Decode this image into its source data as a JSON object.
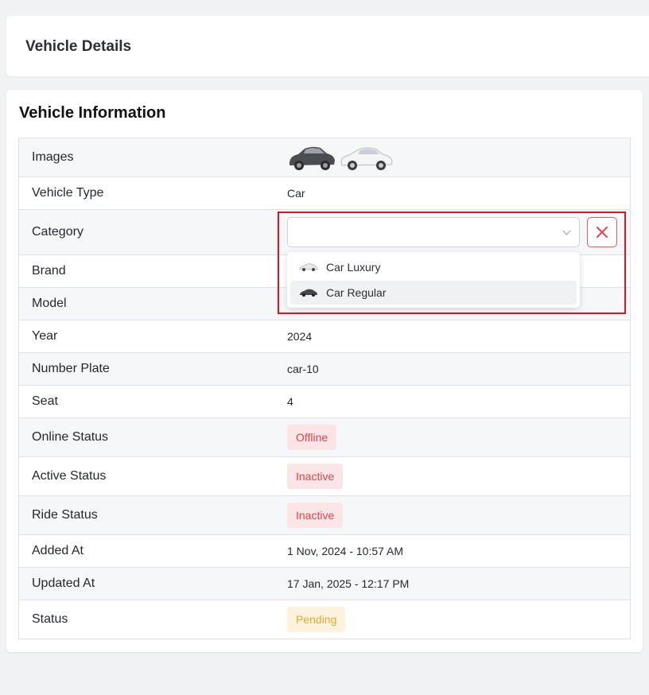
{
  "header": {
    "title": "Vehicle Details"
  },
  "section": {
    "title": "Vehicle Information"
  },
  "rows": [
    {
      "label": "Images"
    },
    {
      "label": "Vehicle Type",
      "value": "Car"
    },
    {
      "label": "Category"
    },
    {
      "label": "Brand"
    },
    {
      "label": "Model"
    },
    {
      "label": "Year",
      "value": "2024"
    },
    {
      "label": "Number Plate",
      "value": "car-10"
    },
    {
      "label": "Seat",
      "value": "4"
    },
    {
      "label": "Online Status",
      "badge": "Offline"
    },
    {
      "label": "Active Status",
      "badge": "Inactive"
    },
    {
      "label": "Ride Status",
      "badge": "Inactive"
    },
    {
      "label": "Added At",
      "value": "1 Nov, 2024 - 10:57 AM"
    },
    {
      "label": "Updated At",
      "value": "17 Jan, 2025 - 12:17 PM"
    },
    {
      "label": "Status",
      "badge": "Pending"
    }
  ],
  "category_select": {
    "selected": "",
    "options": [
      "Car Luxury",
      "Car Regular"
    ],
    "hovered_option": "Car Regular"
  },
  "colors": {
    "danger_badge_bg": "#fbe5e6",
    "danger_text": "#e5434d",
    "warning_badge_bg": "#fcf2de",
    "warning_text": "#e7a92b",
    "highlight_border": "#e3141b"
  },
  "icons": [
    "chevron-down-icon",
    "close-icon",
    "car-image-icon"
  ]
}
